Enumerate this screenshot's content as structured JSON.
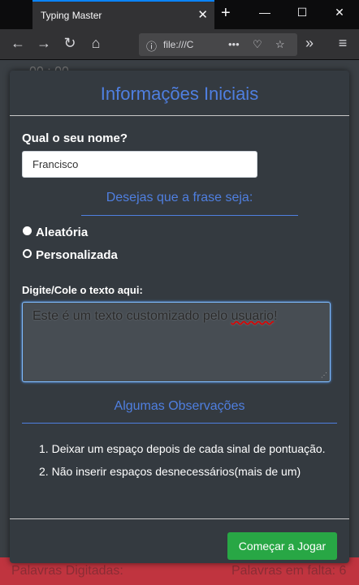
{
  "browser": {
    "tab_title": "Typing Master",
    "url": "file:///C"
  },
  "background": {
    "bottom_left": "Palavras Digitadas:",
    "bottom_right": "Palavras em falta: 6",
    "time": "00 : 00"
  },
  "modal": {
    "title": "Informações Iniciais",
    "name_label": "Qual o seu nome?",
    "name_value": "Francisco",
    "phrase_title": "Desejas que a frase seja:",
    "options": [
      {
        "label": "Aleatória",
        "selected": true
      },
      {
        "label": "Personalizada",
        "selected": false
      }
    ],
    "text_label": "Digite/Cole o texto aqui:",
    "text_value_1": "Este é um texto customizado pelo ",
    "text_value_2": "usuario",
    "text_value_3": "!",
    "obs_title": "Algumas Observações",
    "obs_items": [
      "Deixar um espaço depois de cada sinal de pontuação.",
      "Não inserir espaços desnecessários(mais de um)"
    ],
    "start_button": "Começar a Jogar"
  },
  "colors": {
    "accent": "#4f7fe0",
    "button": "#28a745",
    "modal_bg": "#343a40"
  }
}
